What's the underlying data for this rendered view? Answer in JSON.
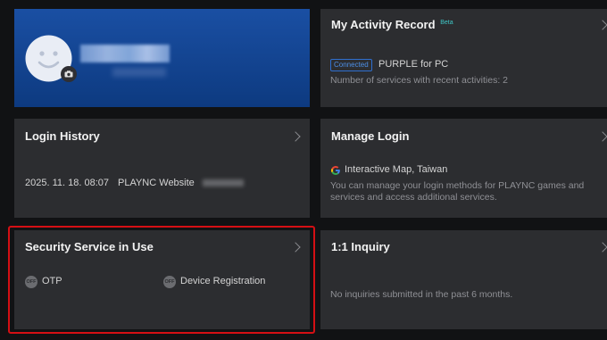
{
  "profile": {
    "avatar_icon": "smiley-face-icon",
    "camera_icon": "camera-icon"
  },
  "activity": {
    "title": "My Activity Record",
    "beta": "Beta",
    "status_badge": "Connected",
    "service": "PURPLE for PC",
    "summary": "Number of services with recent activities: 2"
  },
  "login_history": {
    "title": "Login History",
    "date": "2025. 11. 18. 08:07",
    "site": "PLAYNC Website"
  },
  "manage_login": {
    "title": "Manage Login",
    "account": "Interactive Map, Taiwan",
    "account_icon": "google-icon",
    "description_line1": "You can manage your login methods for PLAYNC games and",
    "description_line2": "services and access additional services."
  },
  "security": {
    "title": "Security Service in Use",
    "off_label": "OFF",
    "items": [
      {
        "label": "OTP",
        "status": "OFF"
      },
      {
        "label": "Device Registration",
        "status": "OFF"
      }
    ]
  },
  "inquiry": {
    "title": "1:1 Inquiry",
    "message": "No inquiries submitted in the past 6 months."
  },
  "colors": {
    "highlight": "#d40f14",
    "accent": "#2f6fcf",
    "beta": "#3fc6c6"
  }
}
